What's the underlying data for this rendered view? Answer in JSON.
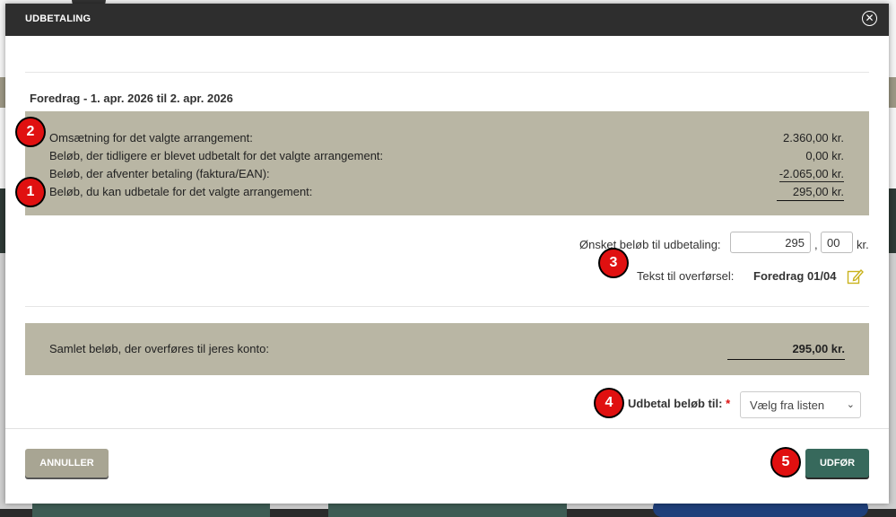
{
  "modal": {
    "title": "UDBETALING",
    "close_icon": "close-circle-icon"
  },
  "event": {
    "title": "Foredrag - 1. apr. 2026 til 2. apr. 2026"
  },
  "summary": {
    "rows": [
      {
        "label": "Omsætning for det valgte arrangement:",
        "value": "2.360,00 kr."
      },
      {
        "label": "Beløb, der tidligere er blevet udbetalt for det valgte arrangement:",
        "value": "0,00 kr."
      },
      {
        "label": "Beløb, der afventer betaling (faktura/EAN):",
        "value": "-2.065,00 kr."
      },
      {
        "label": "Beløb, du kan udbetale for det valgte arrangement:",
        "value": "295,00 kr."
      }
    ]
  },
  "amount": {
    "label": "Ønsket beløb til udbetaling:",
    "kroner": "295",
    "separator": ",",
    "oere": "00",
    "unit": "kr."
  },
  "transfer_text": {
    "label": "Tekst til overførsel:",
    "value": "Foredrag 01/04",
    "edit_icon": "pencil-edit-icon"
  },
  "total": {
    "label": "Samlet beløb, der overføres til jeres konto:",
    "value": "295,00 kr."
  },
  "payout_to": {
    "label": "Udbetal beløb til:",
    "required_mark": "*",
    "selected": "Vælg fra listen"
  },
  "badges": [
    "2",
    "1",
    "3",
    "4",
    "5"
  ],
  "buttons": {
    "cancel": "ANNULLER",
    "submit": "UDFØR"
  },
  "colors": {
    "header_bg": "#2e2e2e",
    "summary_bg": "#b9b6a4",
    "submit_bg": "#37695c",
    "cancel_bg": "#a8a593",
    "badge_bg": "#e01010"
  }
}
